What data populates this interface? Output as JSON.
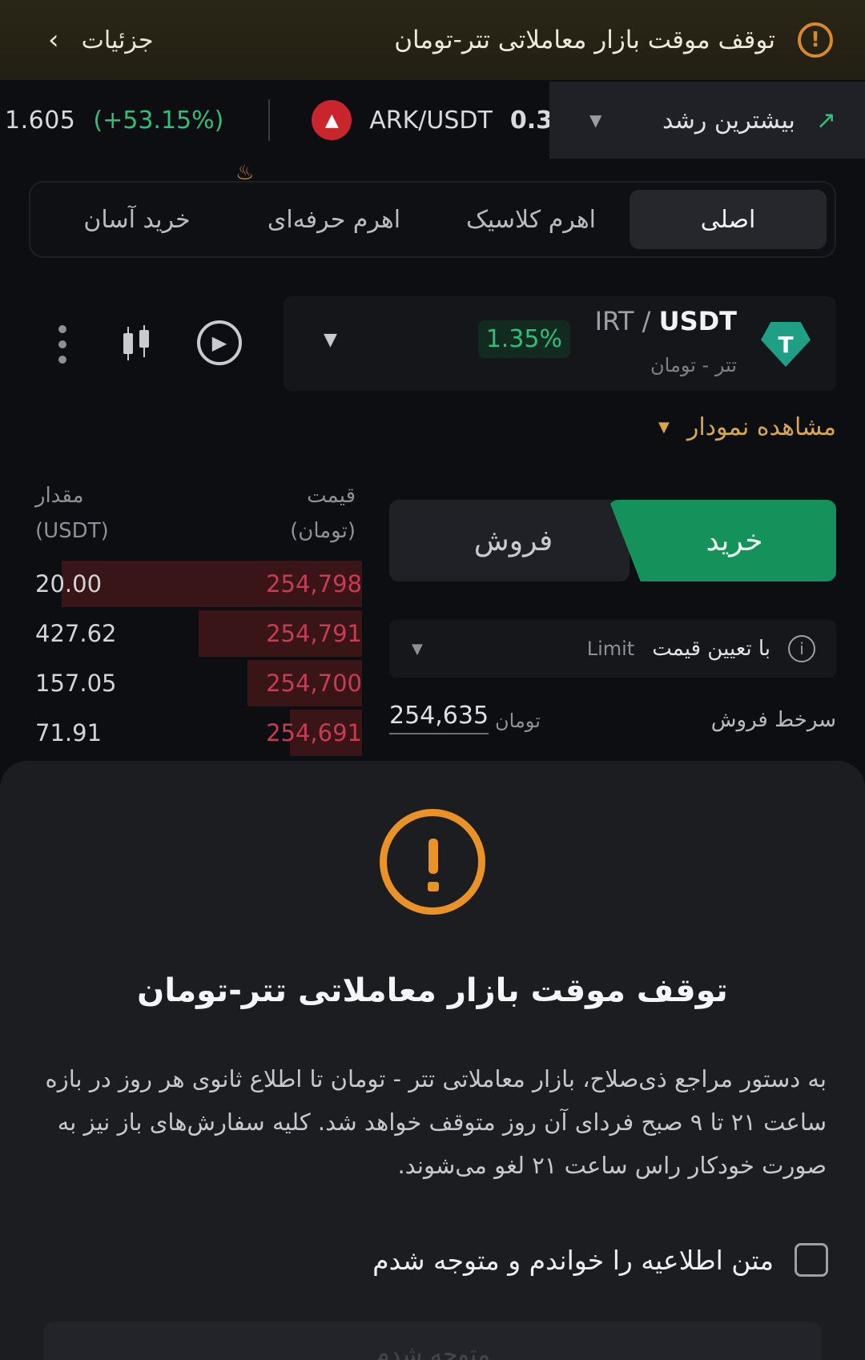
{
  "banner": {
    "details_label": "جزئیات",
    "title": "توقف موقت بازار معاملاتی تتر-تومان",
    "back_glyph": "‹",
    "warn_glyph": "!"
  },
  "ticker": {
    "price_1": "1.605",
    "change_1": "(+53.15%)",
    "pair_2": "ARK/USDT",
    "price_2": "0.3",
    "top_gainers_label": "بیشترین رشد",
    "trend_glyph": "↗"
  },
  "tabs": [
    {
      "label": "اصلی",
      "active": true
    },
    {
      "label": "اهرم کلاسیک",
      "active": false
    },
    {
      "label": "اهرم حرفه‌ای",
      "active": false
    },
    {
      "label": "خرید آسان",
      "active": false
    }
  ],
  "market": {
    "base": "USDT",
    "quote": "IRT",
    "separator": "/",
    "subtitle": "تتر - تومان",
    "change_pct": "1.35%",
    "icon_letter": "T"
  },
  "view_chart_label": "مشاهده نمودار",
  "order_book": {
    "price_header": "قیمت",
    "price_unit": "(تومان)",
    "amount_header": "مقدار",
    "amount_unit": "(USDT)",
    "rows": [
      {
        "price": "254,798",
        "amount": "20.00",
        "depth": 0.92
      },
      {
        "price": "254,791",
        "amount": "427.62",
        "depth": 0.5
      },
      {
        "price": "254,700",
        "amount": "157.05",
        "depth": 0.35
      },
      {
        "price": "254,691",
        "amount": "71.91",
        "depth": 0.22
      }
    ]
  },
  "trade": {
    "buy_label": "خرید",
    "sell_label": "فروش",
    "order_type_label": "با تعیین قیمت",
    "order_type_en": "Limit",
    "ask_label": "سرخط فروش",
    "ask_unit": "تومان",
    "ask_value": "254,635"
  },
  "sheet": {
    "title": "توقف موقت بازار معاملاتی تتر-تومان",
    "body": "به دستور مراجع ذی‌صلاح، بازار معاملاتی تتر - تومان تا اطلاع ثانوی هر روز در بازه ساعت ۲۱ تا ۹ صبح فردای آن روز متوقف خواهد شد. کلیه سفارش‌های باز نیز به صورت خودکار راس ساعت ۲۱ لغو می‌شوند.",
    "ack_label": "متن اطلاعیه را خواندم و متوجه شدم",
    "confirm_label": "متوجه شدم"
  },
  "colors": {
    "accent_green": "#15915c",
    "ask_red": "#c73c52",
    "warning_orange": "#eb9226",
    "gold": "#d9a74a"
  }
}
